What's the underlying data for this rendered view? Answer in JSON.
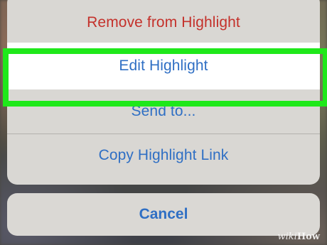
{
  "action_sheet": {
    "items": [
      {
        "label": "Remove from Highlight",
        "style": "destructive",
        "color": "#c4312b"
      },
      {
        "label": "Edit Highlight",
        "style": "default",
        "highlighted": true
      },
      {
        "label": "Send to...",
        "style": "default"
      },
      {
        "label": "Copy Highlight Link",
        "style": "default"
      }
    ],
    "cancel_label": "Cancel",
    "accent_color": "#2f6fc4",
    "highlight_color": "#1fe81a"
  },
  "watermark": {
    "prefix": "wiki",
    "suffix": "How"
  }
}
